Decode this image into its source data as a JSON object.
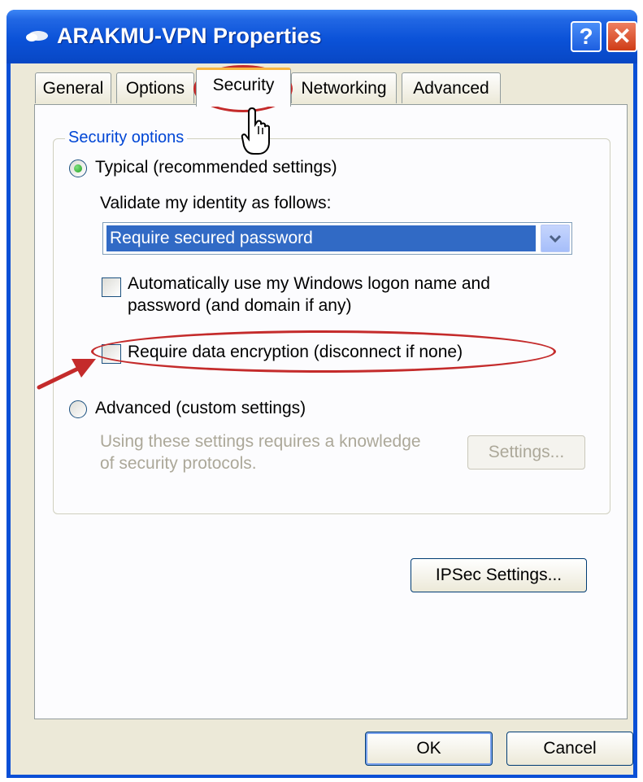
{
  "window": {
    "title": "ARAKMU-VPN Properties",
    "help_symbol": "?",
    "close_symbol": "✕"
  },
  "tabs": [
    {
      "label": "General",
      "active": false
    },
    {
      "label": "Options",
      "active": false
    },
    {
      "label": "Security",
      "active": true
    },
    {
      "label": "Networking",
      "active": false
    },
    {
      "label": "Advanced",
      "active": false
    }
  ],
  "security": {
    "group_label": "Security options",
    "typical": {
      "label": "Typical (recommended settings)",
      "selected": true
    },
    "validate_label": "Validate my identity as follows:",
    "identity_select": {
      "value": "Require secured password"
    },
    "auto_logon": {
      "label_line1": "Automatically use my Windows logon name and",
      "label_line2": "password (and domain if any)",
      "checked": false
    },
    "require_encryption": {
      "label": "Require data encryption (disconnect if none)",
      "checked": false
    },
    "advanced": {
      "label": "Advanced (custom settings)",
      "selected": false
    },
    "advanced_note_line1": "Using these settings requires a knowledge",
    "advanced_note_line2": "of security protocols.",
    "settings_button": "Settings...",
    "ipsec_button": "IPSec Settings..."
  },
  "footer": {
    "ok_button": "OK",
    "cancel_button": "Cancel"
  },
  "icons": {
    "app_icon": "network-connection-icon",
    "hand_cursor": "hand-pointer-icon",
    "arrow": "red-arrow-icon"
  },
  "colors": {
    "titlebar": "#0a4fd6",
    "dialog_face": "#ece9d8",
    "group_label": "#0046d5",
    "selection": "#316ac5",
    "annotation": "#c42b2b"
  }
}
